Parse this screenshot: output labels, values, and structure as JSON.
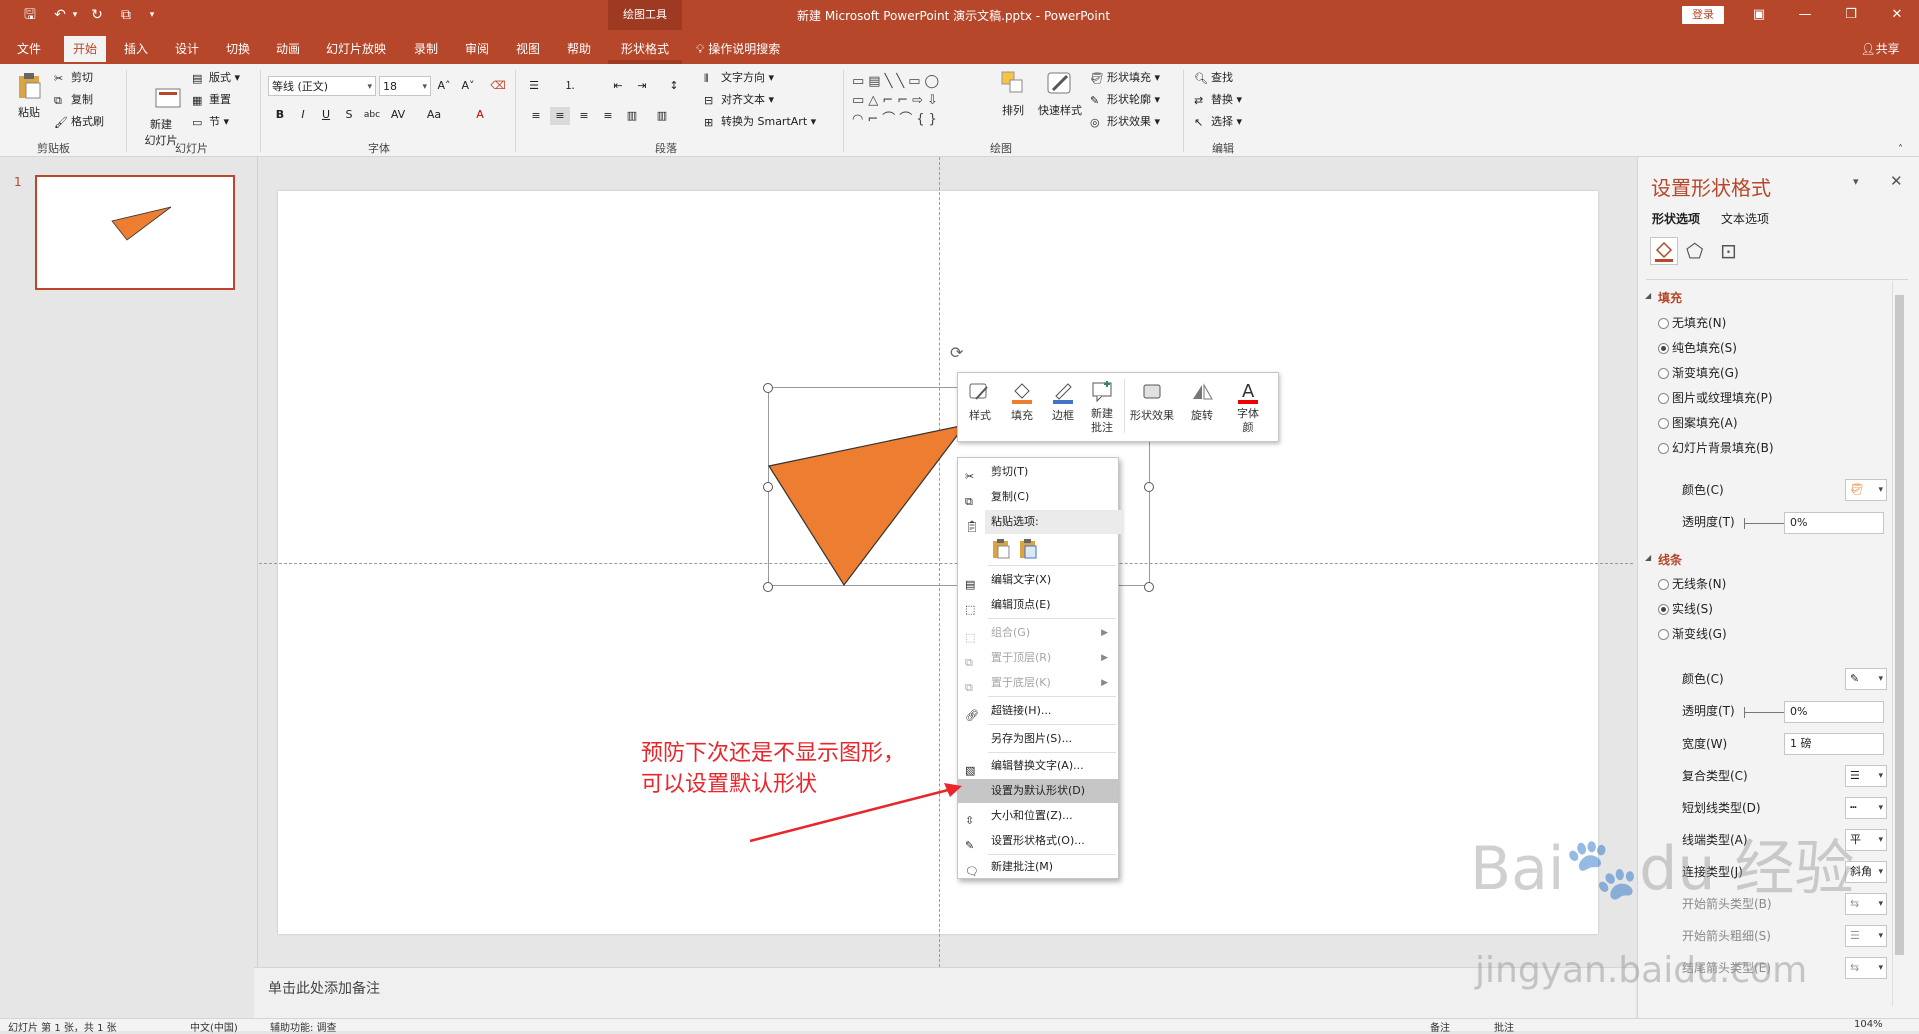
{
  "window": {
    "title": "新建 Microsoft PowerPoint 演示文稿.pptx  -  PowerPoint",
    "context_group": "绘图工具",
    "login": "登录",
    "share": "共享"
  },
  "tabs": [
    "文件",
    "开始",
    "插入",
    "设计",
    "切换",
    "动画",
    "幻灯片放映",
    "录制",
    "审阅",
    "视图",
    "帮助",
    "形状格式"
  ],
  "tell_me": "操作说明搜索",
  "ribbon": {
    "clipboard": {
      "label": "剪贴板",
      "paste": "粘贴",
      "cut": "剪切",
      "copy": "复制",
      "painter": "格式刷"
    },
    "slides": {
      "label": "幻灯片",
      "new_slide": "新建\n幻灯片",
      "layout": "版式",
      "reset": "重置",
      "section": "节"
    },
    "font": {
      "label": "字体",
      "font_name": "等线 (正文)",
      "font_size": "18"
    },
    "paragraph": {
      "label": "段落",
      "text_dir": "文字方向",
      "align_text": "对齐文本",
      "smartart": "转换为 SmartArt"
    },
    "drawing": {
      "label": "绘图",
      "arrange": "排列",
      "quick_styles": "快速样式",
      "fill": "形状填充",
      "outline": "形状轮廓",
      "effects": "形状效果"
    },
    "editing": {
      "label": "编辑",
      "find": "查找",
      "replace": "替换",
      "select": "选择"
    }
  },
  "thumbnails": [
    {
      "index": "1"
    }
  ],
  "notes_placeholder": "单击此处添加备注",
  "status": {
    "slide": "幻灯片 第 1 张，共 1 张",
    "lang": "中文(中国)",
    "accessibility": "辅助功能: 调查",
    "notes": "备注",
    "comments": "批注",
    "zoom": "104%"
  },
  "mini_toolbar": [
    {
      "label": "样式"
    },
    {
      "label": "填充"
    },
    {
      "label": "边框"
    },
    {
      "label": "新建\n批注"
    },
    {
      "label": "形状效果"
    },
    {
      "label": "旋转"
    },
    {
      "label": "字体\n颜"
    }
  ],
  "context_menu": {
    "cut": "剪切(T)",
    "copy": "复制(C)",
    "paste_options": "粘贴选项:",
    "edit_text": "编辑文字(X)",
    "edit_points": "编辑顶点(E)",
    "group": "组合(G)",
    "bring_front": "置于顶层(R)",
    "send_back": "置于底层(K)",
    "hyperlink": "超链接(H)...",
    "save_as_picture": "另存为图片(S)...",
    "alt_text": "编辑替换文字(A)...",
    "set_default": "设置为默认形状(D)",
    "size_pos": "大小和位置(Z)...",
    "format_shape": "设置形状格式(O)...",
    "new_comment": "新建批注(M)"
  },
  "annotation": {
    "line1": "预防下次还是不显示图形，",
    "line2": "可以设置默认形状"
  },
  "format_pane": {
    "title": "设置形状格式",
    "tab_shape": "形状选项",
    "tab_text": "文本选项",
    "fill_header": "填充",
    "fill_options": [
      "无填充(N)",
      "纯色填充(S)",
      "渐变填充(G)",
      "图片或纹理填充(P)",
      "图案填充(A)",
      "幻灯片背景填充(B)"
    ],
    "fill_color": "颜色(C)",
    "fill_transparency": "透明度(T)",
    "fill_transparency_value": "0%",
    "line_header": "线条",
    "line_options": [
      "无线条(N)",
      "实线(S)",
      "渐变线(G)"
    ],
    "line_color": "颜色(C)",
    "line_transparency": "透明度(T)",
    "line_transparency_value": "0%",
    "width": "宽度(W)",
    "width_value": "1 磅",
    "compound": "复合类型(C)",
    "dash": "短划线类型(D)",
    "cap": "线端类型(A)",
    "cap_value": "平",
    "join": "连接类型(J)",
    "join_value": "斜角",
    "begin_arrow": "开始箭头类型(B)",
    "begin_size": "开始箭头粗细(S)",
    "end_arrow": "结尾箭头类型(E)"
  },
  "colors": {
    "accent": "#b7472a",
    "shape_fill": "#ed7d31",
    "annotation": "#e8262c"
  }
}
